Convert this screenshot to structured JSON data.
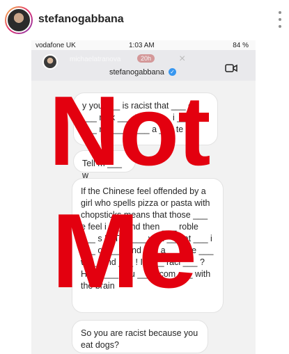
{
  "post": {
    "username": "stefanogabbana"
  },
  "screenshot": {
    "status": {
      "carrier": "vodafone UK",
      "time": "1:03 AM",
      "right": "84 %"
    },
    "story": {
      "username": "michaelatranova",
      "time": "20h"
    },
    "chat": {
      "username": "stefanogabbana",
      "messages": [
        "y you ___ is racist that ___ o? ___ nink ___ tupid ___ i ___ a ___ ro ___ vi ___ a ___ te",
        "Tell m ___ w",
        "If the Chinese feel offended by a girl who spells pizza or pasta with chopsticks means that those ___ e feel i ___ and then ___ roble ___ s !!! The ___ worl ___ at ___ i ___ op ___ and ___ a ___ ste ___ w ___ nd ___ ! Is ___ raci ___ ? Haha ___ you ___ t com ___ with the brain",
        "So you are racist because you eat dogs?"
      ]
    }
  },
  "overlay": {
    "word1": "Not",
    "word2": "Me",
    "color": "#e3000f"
  }
}
